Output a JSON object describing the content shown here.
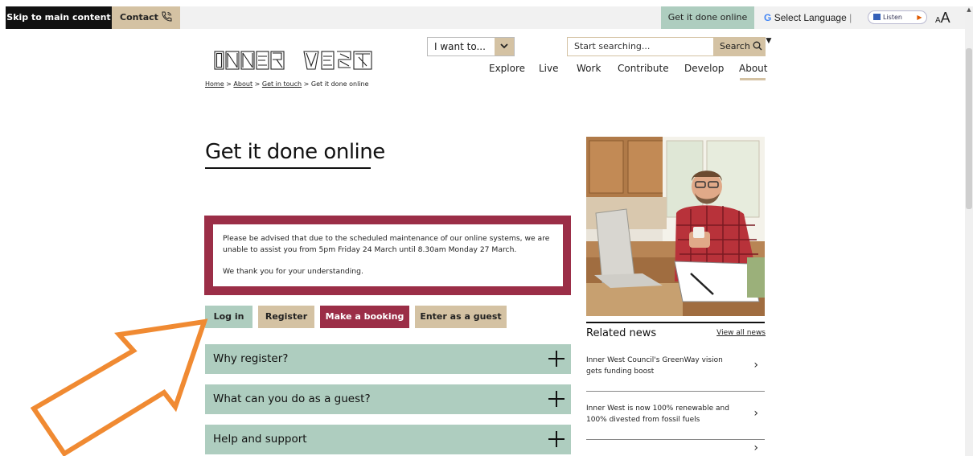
{
  "topbar": {
    "skip_label": "Skip to main content",
    "contact_label": "Contact",
    "get_it_done_label": "Get it done online",
    "translate_g": "G",
    "translate_label": "Select Language",
    "translate_caret": "▼",
    "listen_label": "Listen",
    "text_size_small": "A",
    "text_size_large": "A"
  },
  "header": {
    "logo_alt": "INNER WEST",
    "i_want_label": "I want to...",
    "search_placeholder": "Start searching...",
    "search_button": "Search",
    "nav": [
      "Explore",
      "Live",
      "Work",
      "Contribute",
      "Develop",
      "About"
    ],
    "nav_active": "About"
  },
  "breadcrumb": {
    "items": [
      "Home",
      "About",
      "Get in touch"
    ],
    "current": "Get it done online",
    "separator": ">"
  },
  "main": {
    "title": "Get it done online",
    "notice_line1": "Please be advised that due to the scheduled maintenance of our online systems, we are unable to assist you from 5pm Friday 24 March until 8.30am Monday 27 March.",
    "notice_line2": "We thank you for your understanding.",
    "buttons": {
      "login": "Log in",
      "register": "Register",
      "booking": "Make a booking",
      "guest": "Enter as a guest"
    },
    "accordions": [
      "Why register?",
      "What can you do as a guest?",
      "Help and support"
    ]
  },
  "sidebar": {
    "related_title": "Related news",
    "view_all": "View all news",
    "news": [
      "Inner West Council's GreenWay vision gets funding boost",
      "Inner West is now 100% renewable and 100% divested from fossil fuels"
    ]
  },
  "colors": {
    "sage": "#aecdbf",
    "sand": "#d4c2a3",
    "burgundy": "#9b2e47",
    "annotation_arrow": "#f08a32"
  },
  "icons": {
    "contact": "phone-icon",
    "dropdown": "chevron-down-icon",
    "search": "search-icon",
    "accordion": "plus-icon",
    "news_link": "chevron-right-icon",
    "annotation": "pointer-arrow-icon"
  }
}
